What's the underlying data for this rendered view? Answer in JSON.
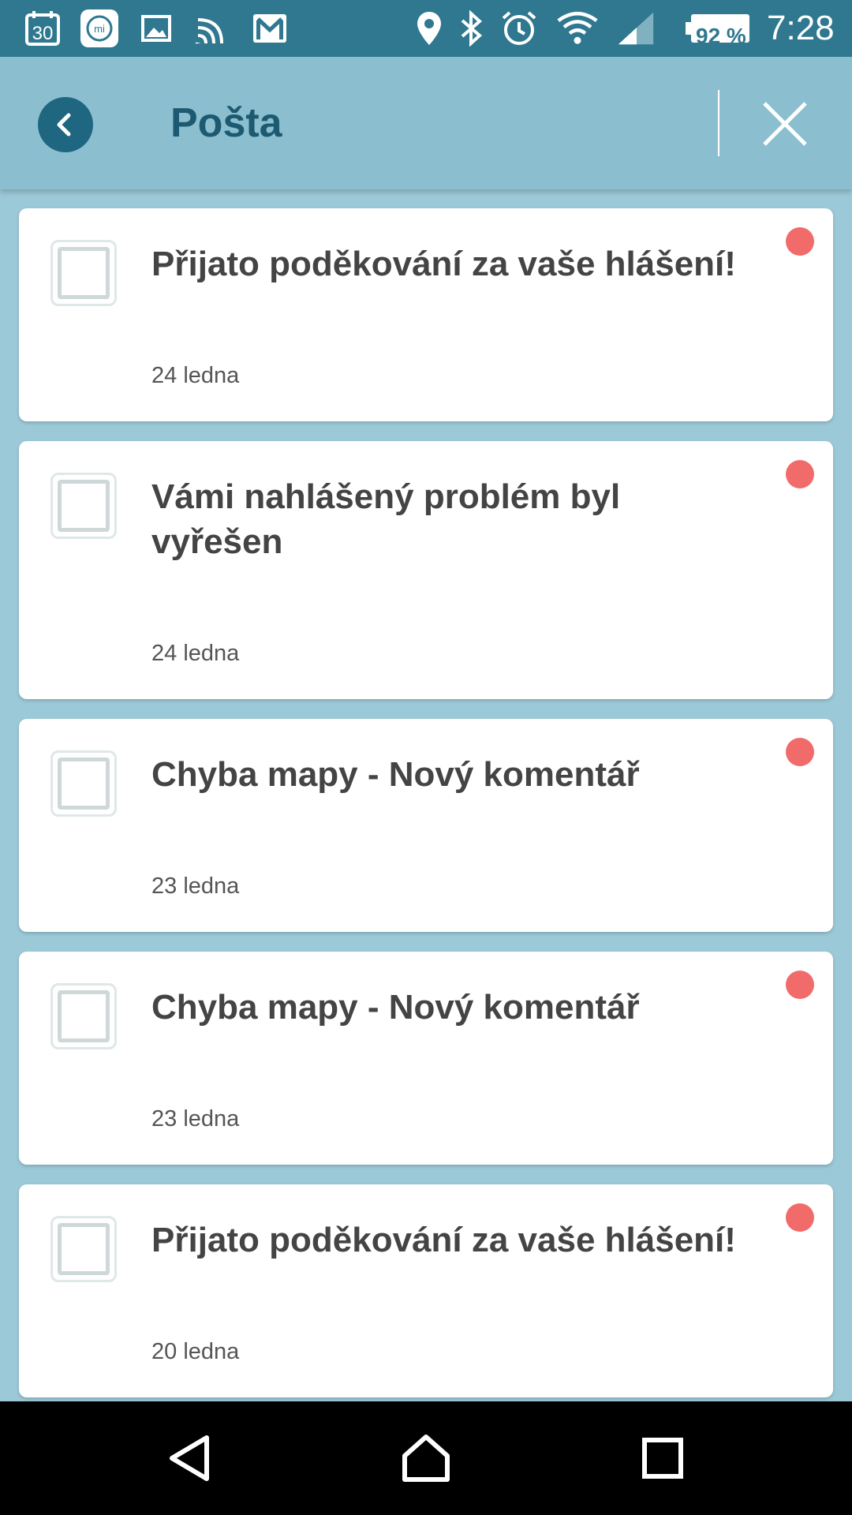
{
  "status_bar": {
    "calendar_day": "30",
    "battery": "92 %",
    "time": "7:28",
    "icons": [
      "calendar-icon",
      "mi-icon",
      "gallery-icon",
      "cast-icon",
      "gmail-icon",
      "location-icon",
      "bluetooth-icon",
      "alarm-icon",
      "wifi-icon",
      "signal-icon",
      "battery-icon"
    ]
  },
  "header": {
    "title": "Pošta"
  },
  "messages": [
    {
      "title": "Přijato poděkování za vaše hlášení!",
      "date": "24 ledna",
      "unread": true
    },
    {
      "title": "Vámi nahlášený problém byl vyřešen",
      "date": "24 ledna",
      "unread": true
    },
    {
      "title": "Chyba mapy - Nový komentář",
      "date": "23 ledna",
      "unread": true
    },
    {
      "title": "Chyba mapy - Nový komentář",
      "date": "23 ledna",
      "unread": true
    },
    {
      "title": "Přijato poděkování za vaše hlášení!",
      "date": "20 ledna",
      "unread": true
    }
  ],
  "colors": {
    "status_bar": "#2f7890",
    "header": "#8bbfcf",
    "background": "#9cc9d7",
    "title": "#1d5a72",
    "unread": "#f26b6b"
  }
}
